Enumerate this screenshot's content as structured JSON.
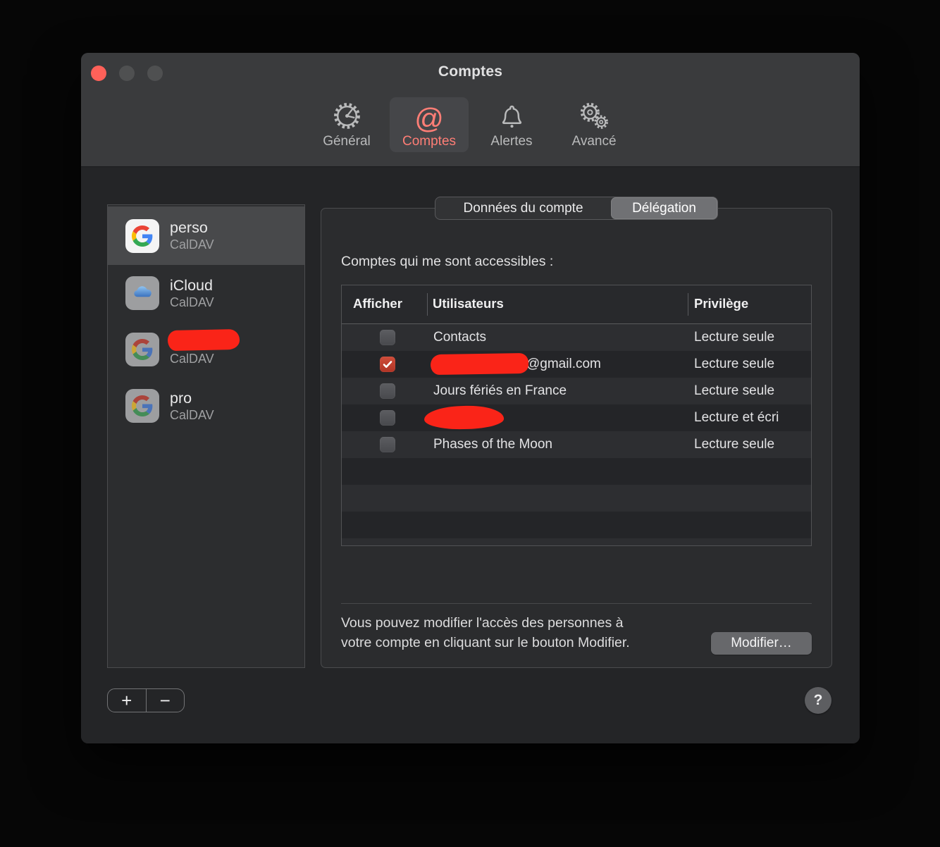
{
  "window": {
    "title": "Comptes"
  },
  "toolbar": {
    "items": [
      {
        "label": "Général",
        "icon": "gear-dial-icon",
        "selected": false
      },
      {
        "label": "Comptes",
        "icon": "at-sign-icon",
        "selected": true
      },
      {
        "label": "Alertes",
        "icon": "bell-icon",
        "selected": false
      },
      {
        "label": "Avancé",
        "icon": "gears-icon",
        "selected": false
      }
    ]
  },
  "sidebar": {
    "accounts": [
      {
        "name": "perso",
        "type": "CalDAV",
        "provider": "google",
        "selected": true,
        "redacted": false
      },
      {
        "name": "iCloud",
        "type": "CalDAV",
        "provider": "icloud",
        "selected": false,
        "redacted": false
      },
      {
        "name": "",
        "type": "CalDAV",
        "provider": "google",
        "selected": false,
        "redacted": true
      },
      {
        "name": "pro",
        "type": "CalDAV",
        "provider": "google",
        "selected": false,
        "redacted": false
      }
    ]
  },
  "panel": {
    "tabs": [
      {
        "label": "Données du compte",
        "selected": false
      },
      {
        "label": "Délégation",
        "selected": true
      }
    ],
    "section_label": "Comptes qui me sont accessibles :",
    "table": {
      "columns": [
        "Afficher",
        "Utilisateurs",
        "Privilège"
      ],
      "rows": [
        {
          "checked": false,
          "user": "Contacts",
          "user_redacted": false,
          "privilege": "Lecture seule"
        },
        {
          "checked": true,
          "user": "@gmail.com",
          "user_redacted": true,
          "privilege": "Lecture seule"
        },
        {
          "checked": false,
          "user": "Jours fériés en France",
          "user_redacted": false,
          "privilege": "Lecture seule"
        },
        {
          "checked": false,
          "user": "",
          "user_redacted": true,
          "privilege": "Lecture et écri"
        },
        {
          "checked": false,
          "user": "Phases of the Moon",
          "user_redacted": false,
          "privilege": "Lecture seule"
        }
      ]
    },
    "footer": {
      "line1": "Vous pouvez modifier l'accès des personnes à",
      "line2": "votre compte en cliquant sur le bouton Modifier.",
      "modify_label": "Modifier…"
    }
  },
  "bottom": {
    "add_label": "+",
    "remove_label": "−",
    "help_label": "?"
  },
  "colors": {
    "accent": "#ff7e76",
    "checkbox_checked": "#c64534",
    "redaction": "#fa2418",
    "close_button": "#ff6159",
    "toolbar_bg": "#3a3b3d",
    "content_bg": "#242527"
  }
}
